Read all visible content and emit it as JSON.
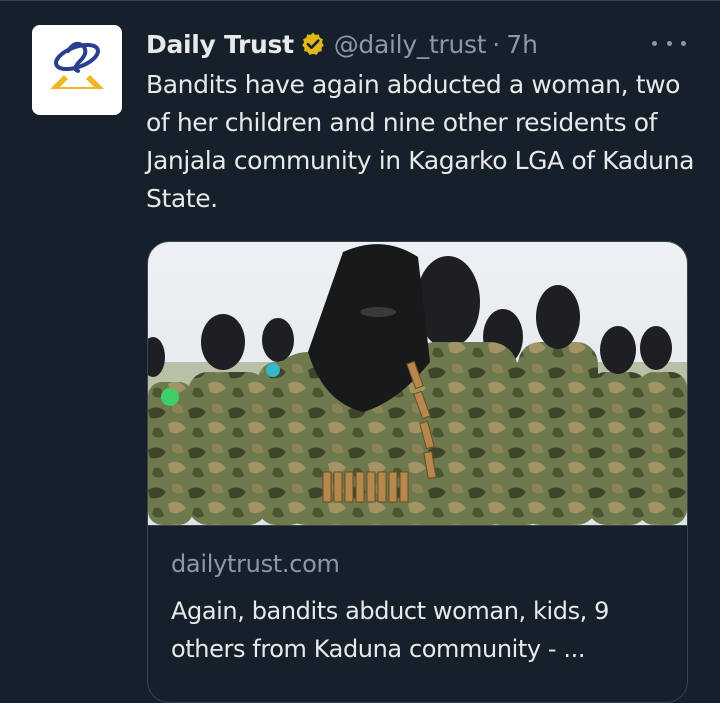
{
  "tweet": {
    "author_name": "Daily Trust",
    "handle": "@daily_trust",
    "separator": "·",
    "time": "7h",
    "text": "Bandits have again abducted a woman, two of her children and nine other residents of Janjala community in Kagarko LGA of Kaduna State."
  },
  "link_card": {
    "domain": "dailytrust.com",
    "title": "Again, bandits abduct woman, kids, 9 others from Kaduna community - ..."
  },
  "colors": {
    "background": "#15202b",
    "primary_text": "#e7e9ea",
    "secondary_text": "#8b98a5",
    "verified_badge": "#e2b719",
    "border": "#38444d"
  },
  "icons": {
    "verified": "verified-gold-badge-icon",
    "more": "more-options-icon",
    "avatar": "daily-trust-logo"
  }
}
